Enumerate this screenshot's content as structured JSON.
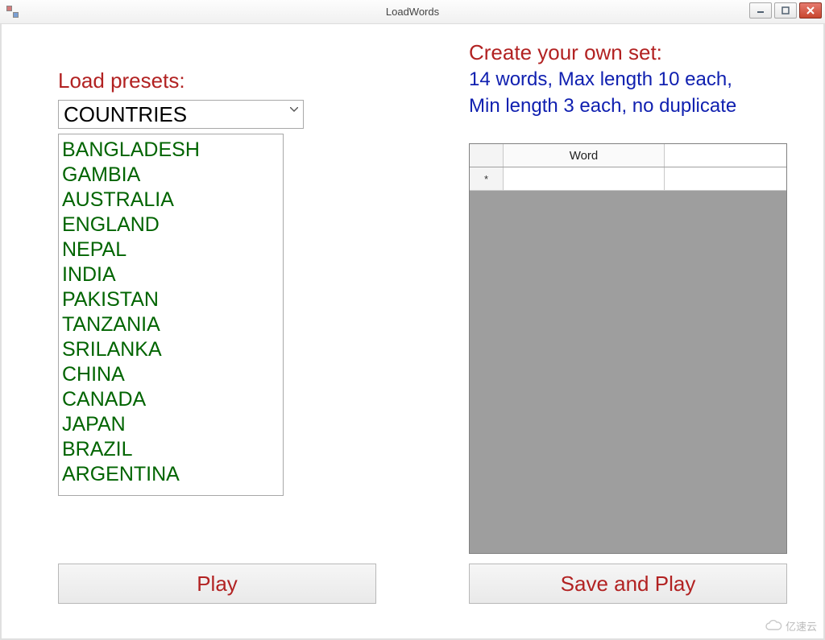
{
  "window": {
    "title": "LoadWords"
  },
  "left": {
    "heading": "Load presets:",
    "combo_value": "COUNTRIES",
    "items": [
      "BANGLADESH",
      "GAMBIA",
      "AUSTRALIA",
      "ENGLAND",
      "NEPAL",
      "INDIA",
      "PAKISTAN",
      "TANZANIA",
      "SRILANKA",
      "CHINA",
      "CANADA",
      "JAPAN",
      "BRAZIL",
      "ARGENTINA"
    ],
    "play_label": "Play"
  },
  "right": {
    "heading": "Create your own set:",
    "rules1": "14 words, Max length 10 each,",
    "rules2": "Min length 3 each, no duplicate",
    "grid": {
      "column_header": "Word",
      "new_row_marker": "*",
      "rows": [
        {
          "word": ""
        }
      ]
    },
    "save_label": "Save and Play"
  },
  "watermark": {
    "text": "亿速云"
  }
}
